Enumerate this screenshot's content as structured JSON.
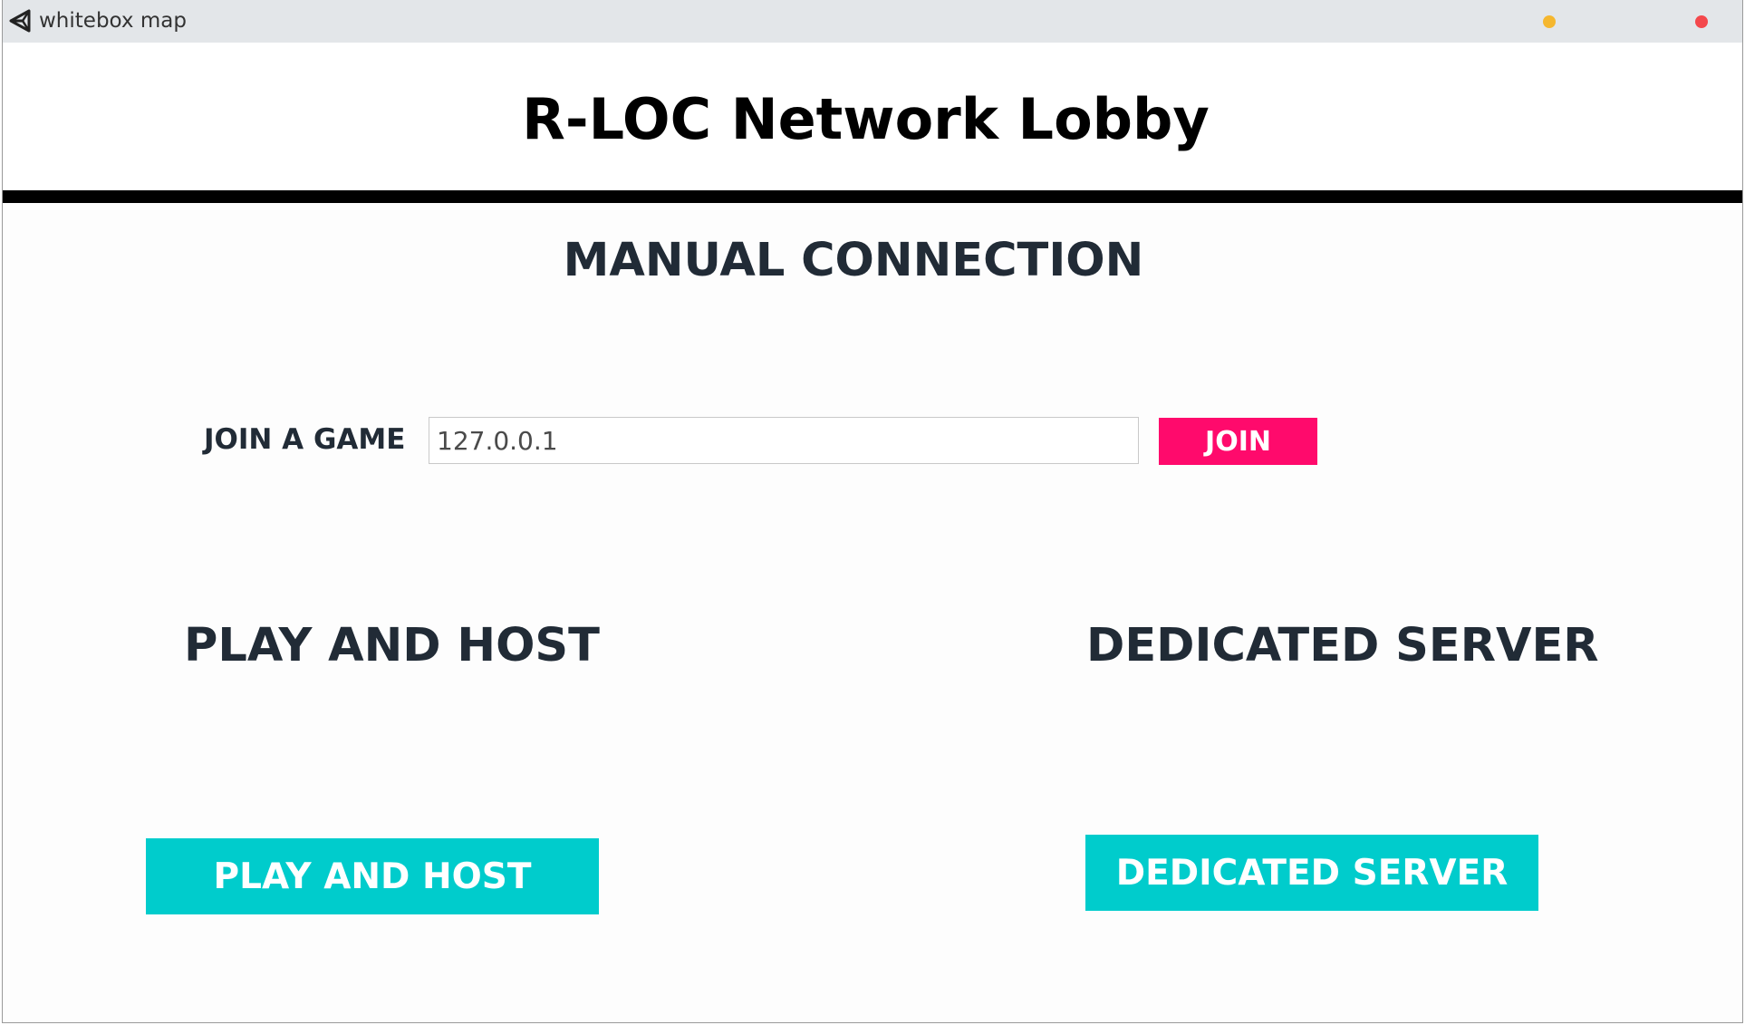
{
  "window": {
    "title": "whitebox map",
    "app_icon": "unity-logo-icon",
    "controls": {
      "minimize_color": "#f5b72f",
      "close_color": "#f4484c"
    }
  },
  "lobby": {
    "title": "R-LOC Network Lobby"
  },
  "manual_connection": {
    "heading": "MANUAL CONNECTION",
    "join_label": "JOIN A GAME",
    "address_value": "127.0.0.1",
    "join_button": "JOIN"
  },
  "play_and_host": {
    "heading": "PLAY AND HOST",
    "button": "PLAY AND HOST"
  },
  "dedicated_server": {
    "heading": "DEDICATED SERVER",
    "button": "DEDICATED SERVER"
  },
  "colors": {
    "join_button": "#ff0a6c",
    "primary_button": "#00cccc",
    "heading_text": "#212b36",
    "divider": "#000000"
  }
}
